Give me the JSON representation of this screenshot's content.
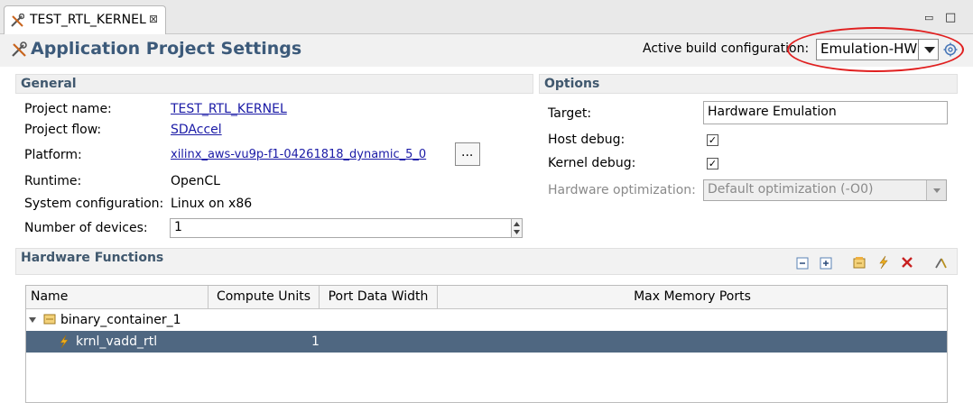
{
  "tab": {
    "title": "TEST_RTL_KERNEL",
    "close_glyph": "⊠"
  },
  "window": {
    "minimize_glyph": "▭",
    "maximize_glyph": "□"
  },
  "header": {
    "title": "Application Project Settings",
    "build_config_label": "Active build configuration:",
    "build_config_value": "Emulation-HW"
  },
  "general": {
    "header": "General",
    "project_name_label": "Project name:",
    "project_name": "TEST_RTL_KERNEL",
    "project_flow_label": "Project flow:",
    "project_flow": "SDAccel",
    "platform_label": "Platform:",
    "platform": "xilinx_aws-vu9p-f1-04261818_dynamic_5_0",
    "platform_browse": "...",
    "runtime_label": "Runtime:",
    "runtime": "OpenCL",
    "system_config_label": "System configuration:",
    "system_config": "Linux on x86",
    "num_devices_label": "Number of devices:",
    "num_devices": "1"
  },
  "options": {
    "header": "Options",
    "target_label": "Target:",
    "target": "Hardware Emulation",
    "host_debug_label": "Host debug:",
    "kernel_debug_label": "Kernel debug:",
    "check_glyph": "✓",
    "hw_opt_label": "Hardware optimization:",
    "hw_opt": "Default optimization (-O0)"
  },
  "hardware_functions": {
    "header": "Hardware Functions",
    "columns": [
      "Name",
      "Compute Units",
      "Port Data Width",
      "Max Memory Ports"
    ],
    "rows": [
      {
        "name": "binary_container_1",
        "compute_units": ""
      },
      {
        "name": "krnl_vadd_rtl",
        "compute_units": "1"
      }
    ]
  },
  "colors": {
    "title": "#3c5a7a",
    "link": "#1a1aa6",
    "selection": "#4f6781",
    "highlight_ellipse": "#e02020"
  }
}
